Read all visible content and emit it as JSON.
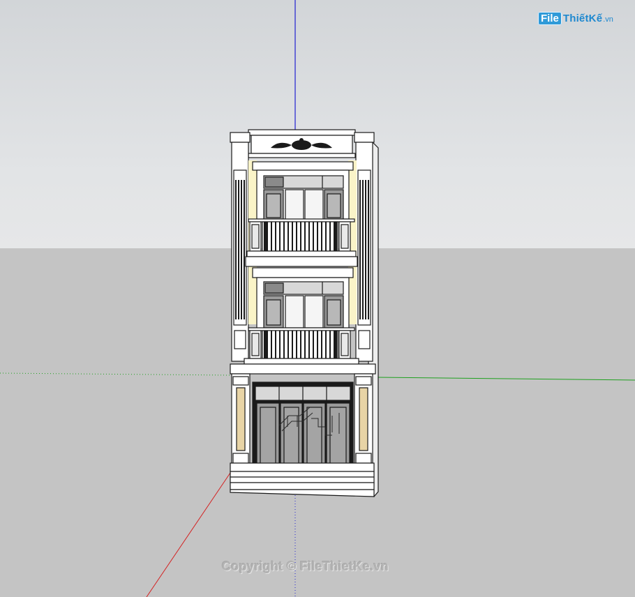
{
  "viewport": {
    "sky_color": "#dfe1e3",
    "ground_color": "#c4c4c4"
  },
  "axes": {
    "red": "#d42020",
    "green": "#1ea01e",
    "blue": "#2020d0"
  },
  "model": {
    "wall_color": "#ffffff",
    "accent_color": "#faf4c8",
    "panel_color": "#e8d4a6",
    "glass_color": "#9a9a9a",
    "dark_color": "#1a1a1a"
  },
  "watermark": {
    "logo_file": "File",
    "logo_name": "ThiếtKế",
    "logo_tld": ".vn",
    "copyright": "Copyright © FileThietKe.vn"
  }
}
